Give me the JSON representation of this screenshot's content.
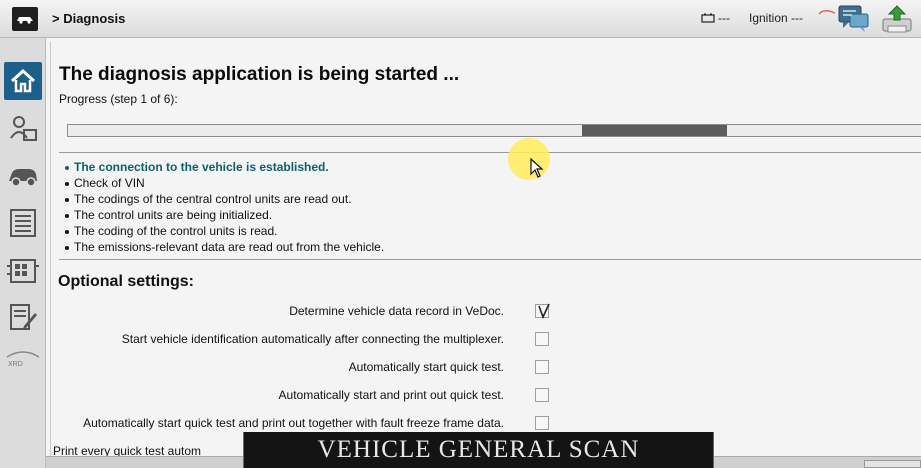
{
  "header": {
    "breadcrumb": "> Diagnosis",
    "battery_status": "---",
    "ignition_status": "Ignition ---"
  },
  "sidebar": {
    "items": [
      {
        "icon": "home-icon",
        "active": true
      },
      {
        "icon": "operator-icon"
      },
      {
        "icon": "vehicle-icon"
      },
      {
        "icon": "list-icon"
      },
      {
        "icon": "control-units-icon"
      },
      {
        "icon": "edit-document-icon"
      },
      {
        "icon": "xrd-icon"
      }
    ],
    "xrd_label": "XRD"
  },
  "main": {
    "title": "The diagnosis application is being started ...",
    "progress_label": "Progress (step 1 of 6):",
    "progress": {
      "segment_start": 0.6,
      "segment_end": 0.77
    },
    "steps": [
      {
        "text": "The connection to the vehicle is established.",
        "current": true
      },
      {
        "text": "Check of VIN"
      },
      {
        "text": "The codings of the central control units are read out."
      },
      {
        "text": "The control units are being initialized."
      },
      {
        "text": "The coding of the control units is read."
      },
      {
        "text": "The emissions-relevant data are read out from the vehicle."
      }
    ],
    "optional_title": "Optional settings:",
    "options": [
      {
        "label": "Determine vehicle data record in VeDoc.",
        "checked": true
      },
      {
        "label": "Start vehicle identification automatically after connecting the multiplexer.",
        "checked": false
      },
      {
        "label": "Automatically start quick test.",
        "checked": false
      },
      {
        "label": "Automatically start and print out quick test.",
        "checked": false
      },
      {
        "label": "Automatically start quick test and print out together with fault freeze frame data.",
        "checked": false
      },
      {
        "label": "Print every quick test autom",
        "checked": false
      }
    ]
  },
  "caption": "VEHICLE GENERAL SCAN",
  "colors": {
    "accent": "#1c5f8a",
    "current_step": "#0f5f6b",
    "progress_fill": "#5c5c5c",
    "cursor_highlight": "#ffec5a"
  }
}
